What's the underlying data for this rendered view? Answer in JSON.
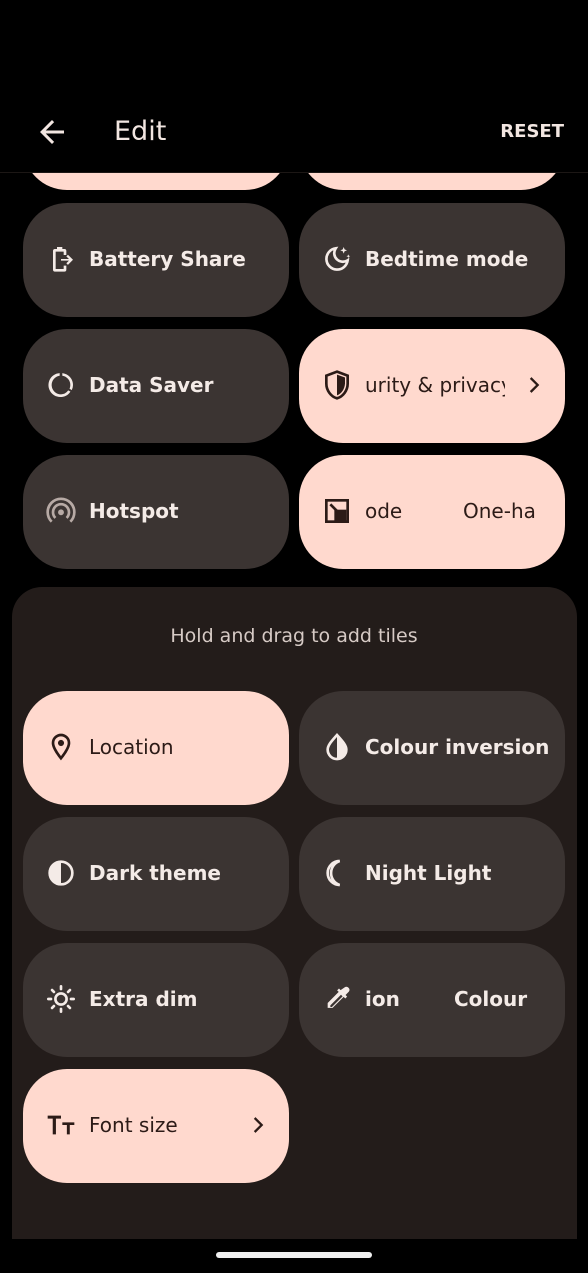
{
  "header": {
    "title": "Edit",
    "reset_label": "RESET"
  },
  "current_tiles": {
    "battery_share": "Battery Share",
    "bedtime_mode": "Bedtime mode",
    "data_saver": "Data Saver",
    "security_privacy_partial": "urity & privacy",
    "hotspot": "Hotspot",
    "one_handed_partial_a": "ode",
    "one_handed_partial_b": "One-ha"
  },
  "add_section": {
    "hint": "Hold and drag to add tiles",
    "location": "Location",
    "colour_inversion": "Colour inversion",
    "dark_theme": "Dark theme",
    "night_light": "Night Light",
    "extra_dim": "Extra dim",
    "colour_correction_partial_a": "ion",
    "colour_correction_partial_b": "Colour c",
    "font_size": "Font size"
  },
  "icons": {
    "back": "arrow-left-icon",
    "battery_share": "battery-share-icon",
    "bedtime": "moon-stars-icon",
    "data_saver": "data-saver-icon",
    "security": "shield-icon",
    "hotspot": "hotspot-icon",
    "one_handed": "one-handed-icon",
    "location": "location-pin-icon",
    "colour_inversion": "invert-colors-icon",
    "dark_theme": "contrast-icon",
    "night_light": "crescent-icon",
    "extra_dim": "brightness-icon",
    "colour_correction": "eyedropper-icon",
    "font_size": "text-size-icon",
    "chevron": "chevron-right-icon"
  },
  "colors": {
    "background": "#000000",
    "tile_inactive": "#3b3432",
    "tile_active": "#ffd9ce",
    "panel": "#231c1a",
    "text_light": "#f4ebe7",
    "text_dark": "#2c1b17"
  }
}
